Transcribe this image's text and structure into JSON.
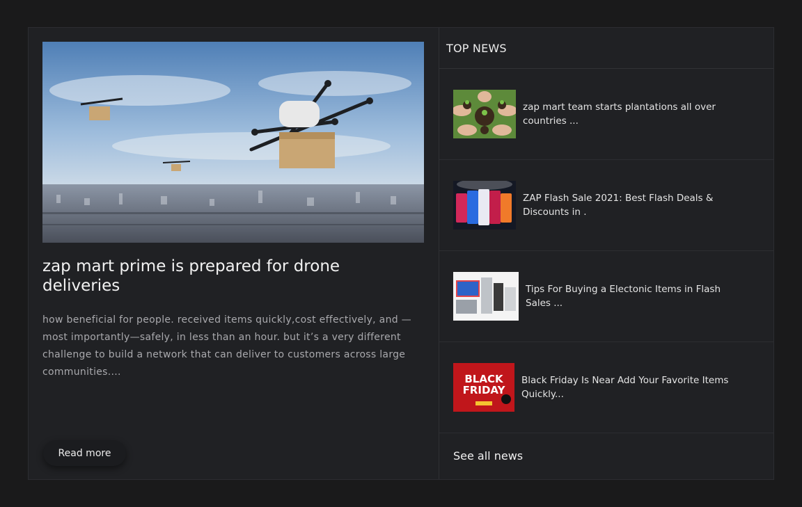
{
  "featured": {
    "image_alt": "drone-delivery-photo",
    "title": "zap mart prime is prepared for drone deliveries",
    "excerpt": "how beneficial for people. received items quickly,cost effectively, and —most importantly—safely, in less than an hour. but it’s a very different challenge to build a network that can deliver to customers across large communities....",
    "read_more_label": "Read more"
  },
  "sidebar": {
    "heading": "TOP NEWS",
    "items": [
      {
        "title": "zap mart team starts plantations all over countries ...",
        "thumb": "plant-hands-image"
      },
      {
        "title": "ZAP Flash Sale 2021: Best Flash Deals & Discounts in .",
        "thumb": "smartphones-image"
      },
      {
        "title": "Tips For Buying a Electonic Items in Flash Sales ...",
        "thumb": "electronics-image"
      },
      {
        "title": "Black Friday Is Near Add Your Favorite Items Quickly...",
        "thumb": "black-friday-image"
      }
    ],
    "see_all_label": "See all news"
  },
  "black_friday_thumb": {
    "line1": "BLACK",
    "line2": "FRIDAY"
  }
}
